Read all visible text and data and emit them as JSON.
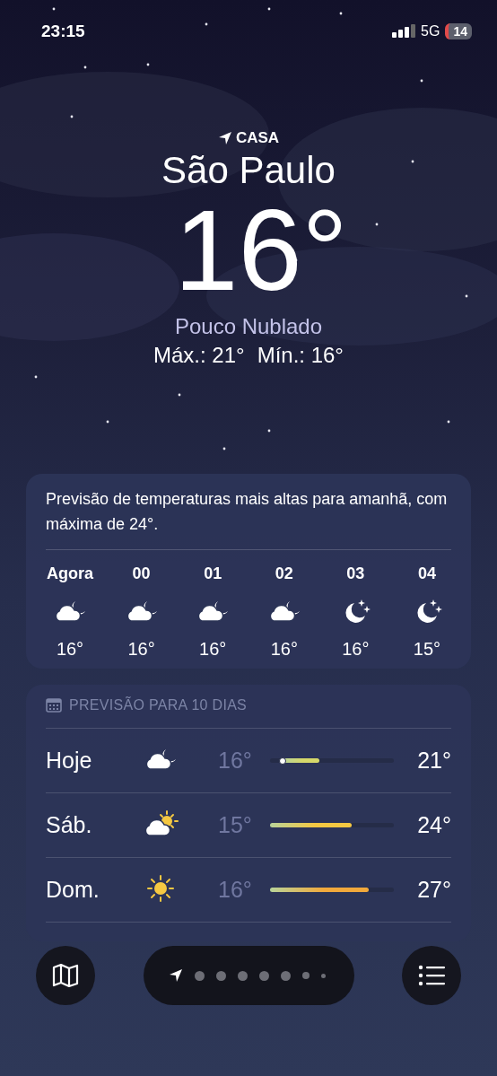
{
  "status_bar": {
    "time": "23:15",
    "network": "5G",
    "battery": "14"
  },
  "location": {
    "label": "CASA",
    "city": "São Paulo",
    "temperature": "16°",
    "condition": "Pouco Nublado",
    "max": "Máx.: 21°",
    "min": "Mín.: 16°"
  },
  "hourly": {
    "summary": "Previsão de temperaturas mais altas para amanhã, com máxima de 24°.",
    "hours": [
      {
        "time": "Agora",
        "kind": "cloud-moon",
        "temp": "16°"
      },
      {
        "time": "00",
        "kind": "cloud-moon",
        "temp": "16°"
      },
      {
        "time": "01",
        "kind": "cloud-moon",
        "temp": "16°"
      },
      {
        "time": "02",
        "kind": "cloud-moon",
        "temp": "16°"
      },
      {
        "time": "03",
        "kind": "moon-stars",
        "temp": "16°"
      },
      {
        "time": "04",
        "kind": "moon-stars",
        "temp": "15°"
      }
    ]
  },
  "daily": {
    "title": "PREVISÃO PARA 10 DIAS",
    "days": [
      {
        "day": "Hoje",
        "kind": "cloud-moon",
        "low": "16°",
        "high": "21°",
        "level": 0.3,
        "current": true,
        "color": "#d6d86a"
      },
      {
        "day": "Sáb.",
        "kind": "cloud-sun",
        "low": "15°",
        "high": "24°",
        "level": 0.66,
        "current": false,
        "color": "#f5c842"
      },
      {
        "day": "Dom.",
        "kind": "sun",
        "low": "16°",
        "high": "27°",
        "level": 0.8,
        "current": false,
        "color": "#f2a93b"
      }
    ]
  },
  "pages": [
    {
      "kind": "location",
      "selected": true
    },
    {
      "kind": "dot",
      "selected": false
    },
    {
      "kind": "dot",
      "selected": false
    },
    {
      "kind": "dot",
      "selected": false
    },
    {
      "kind": "dot",
      "selected": false
    },
    {
      "kind": "dot",
      "selected": false
    },
    {
      "kind": "small",
      "selected": false
    },
    {
      "kind": "tiny",
      "selected": false
    }
  ]
}
